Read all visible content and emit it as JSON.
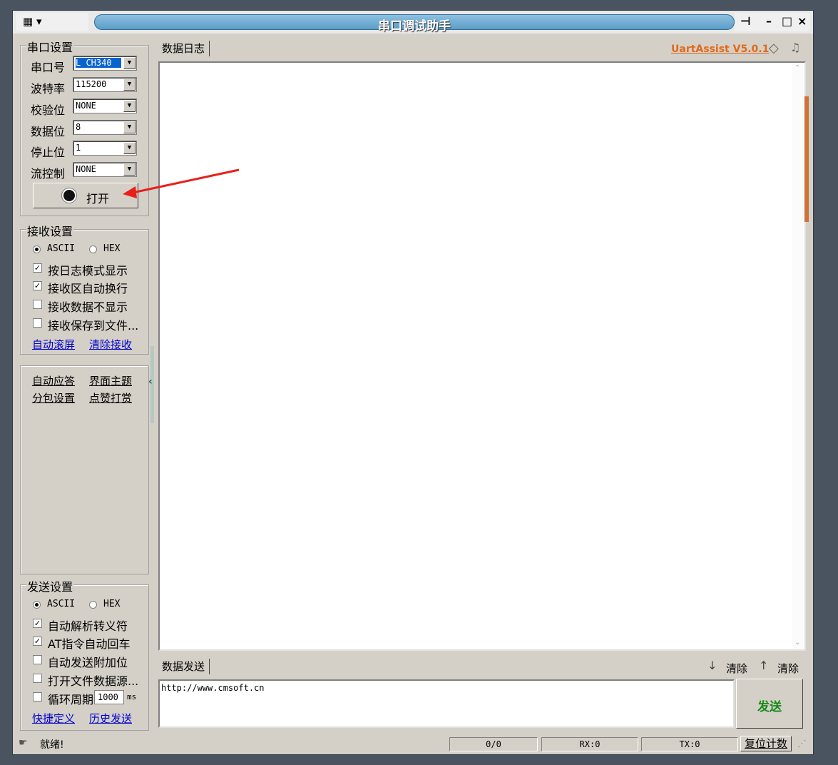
{
  "window": {
    "title": "串口调试助手"
  },
  "serial_settings": {
    "title": "串口设置",
    "fields": [
      {
        "label": "串口号",
        "value": "L CH340"
      },
      {
        "label": "波特率",
        "value": "115200"
      },
      {
        "label": "校验位",
        "value": "NONE"
      },
      {
        "label": "数据位",
        "value": "8"
      },
      {
        "label": "停止位",
        "value": "1"
      },
      {
        "label": "流控制",
        "value": "NONE"
      }
    ],
    "open_button": "打开"
  },
  "receive_settings": {
    "title": "接收设置",
    "mode_ascii": "ASCII",
    "mode_hex": "HEX",
    "options": [
      {
        "label": "按日志模式显示",
        "checked": true
      },
      {
        "label": "接收区自动换行",
        "checked": true
      },
      {
        "label": "接收数据不显示",
        "checked": false
      },
      {
        "label": "接收保存到文件...",
        "checked": false
      }
    ],
    "link_autoscroll": "自动滚屏",
    "link_clear": "清除接收"
  },
  "extra_links": {
    "auto_reply": "自动应答",
    "theme": "界面主题",
    "packet": "分包设置",
    "donate": "点赞打赏"
  },
  "send_settings": {
    "title": "发送设置",
    "mode_ascii": "ASCII",
    "mode_hex": "HEX",
    "options": [
      {
        "label": "自动解析转义符",
        "checked": true
      },
      {
        "label": "AT指令自动回车",
        "checked": true
      },
      {
        "label": "自动发送附加位",
        "checked": false
      },
      {
        "label": "打开文件数据源...",
        "checked": false
      }
    ],
    "loop_label": "循环周期",
    "loop_value": "1000",
    "loop_unit": "ms",
    "link_shortcut": "快捷定义",
    "link_history": "历史发送"
  },
  "log": {
    "tab": "数据日志",
    "brand": "UartAssist V5.0.1"
  },
  "send": {
    "tab": "数据发送",
    "clear1": "清除",
    "clear2": "清除",
    "text": "http://www.cmsoft.cn",
    "send_button": "发送"
  },
  "statusbar": {
    "ready": "就绪!",
    "count": "0/0",
    "rx": "RX:0",
    "tx": "TX:0",
    "reset": "复位计数"
  },
  "colors": {
    "brand": "#e06a1a",
    "send_button": "#1a8a1a",
    "arrow": "#e8201a",
    "scroll_thumb": "#d0703a"
  }
}
